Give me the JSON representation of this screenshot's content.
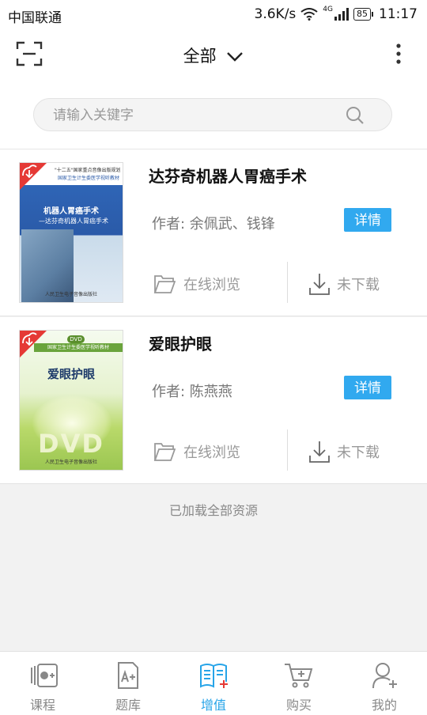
{
  "status_bar": {
    "carrier": "中国联通",
    "speed": "3.6K/s",
    "network": "4G",
    "battery": "85",
    "time": "11:17"
  },
  "header": {
    "title": "全部",
    "scan_icon": "scan-icon",
    "more_icon": "more-vertical-icon"
  },
  "search": {
    "placeholder": "请输入关键字",
    "icon": "search-icon"
  },
  "books": [
    {
      "title": "达芬奇机器人胃癌手术",
      "author": "作者: 余佩武、钱锋",
      "detail_label": "详情",
      "online_label": "在线浏览",
      "download_label": "未下载",
      "cover": {
        "series": "\"十二五\"国家重点音像出版规划",
        "subtitle": "国家卫生计生委医学视听教材",
        "title_line1": "机器人胃癌手术",
        "title_line2": "—达芬奇机器人胃癌手术",
        "publisher": "人民卫生电子音像出版社"
      }
    },
    {
      "title": "爱眼护眼",
      "author": "作者: 陈燕燕",
      "detail_label": "详情",
      "online_label": "在线浏览",
      "download_label": "未下载",
      "cover": {
        "badge": "DVD",
        "band": "国家卫生计生委医学视听教材",
        "title": "爱眼护眼",
        "big": "DVD",
        "publisher": "人民卫生电子音像出版社"
      }
    }
  ],
  "footer_text": "已加载全部资源",
  "nav": [
    {
      "label": "课程",
      "icon": "course-icon",
      "active": false
    },
    {
      "label": "题库",
      "icon": "question-bank-icon",
      "active": false
    },
    {
      "label": "增值",
      "icon": "value-added-book-icon",
      "active": true
    },
    {
      "label": "购买",
      "icon": "cart-icon",
      "active": false
    },
    {
      "label": "我的",
      "icon": "profile-icon",
      "active": false
    }
  ],
  "colors": {
    "accent": "#31a9ef",
    "nav_active": "#27a4e8",
    "background": "#f2f2f2"
  }
}
